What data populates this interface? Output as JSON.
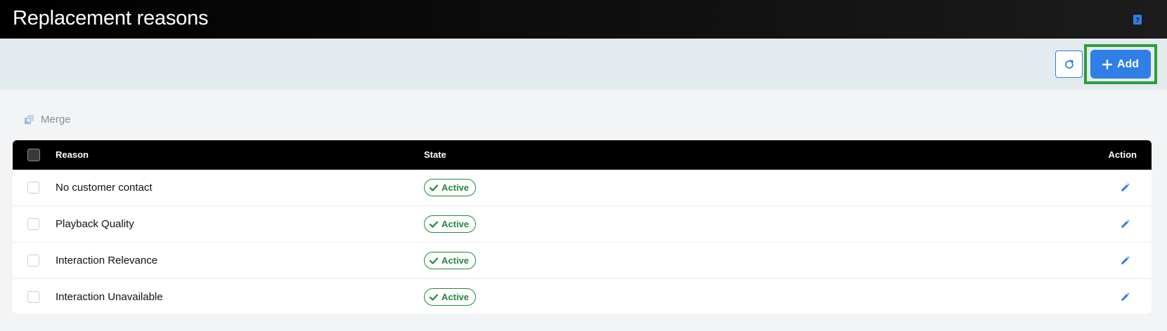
{
  "header": {
    "title": "Replacement reasons",
    "help_icon": "help-book-icon"
  },
  "toolbar": {
    "refresh_icon": "refresh-icon",
    "add_label": "Add",
    "add_icon": "plus-icon"
  },
  "actions": {
    "merge_label": "Merge",
    "merge_icon": "merge-icon"
  },
  "table": {
    "columns": {
      "reason": "Reason",
      "state": "State",
      "action": "Action"
    },
    "rows": [
      {
        "reason": "No customer contact",
        "state": "Active"
      },
      {
        "reason": "Playback Quality",
        "state": "Active"
      },
      {
        "reason": "Interaction Relevance",
        "state": "Active"
      },
      {
        "reason": "Interaction Unavailable",
        "state": "Active"
      }
    ]
  },
  "colors": {
    "accent": "#2f7fe6",
    "active_green": "#1e8a3c",
    "highlight": "#2f9e35",
    "header_bg": "#000000"
  }
}
